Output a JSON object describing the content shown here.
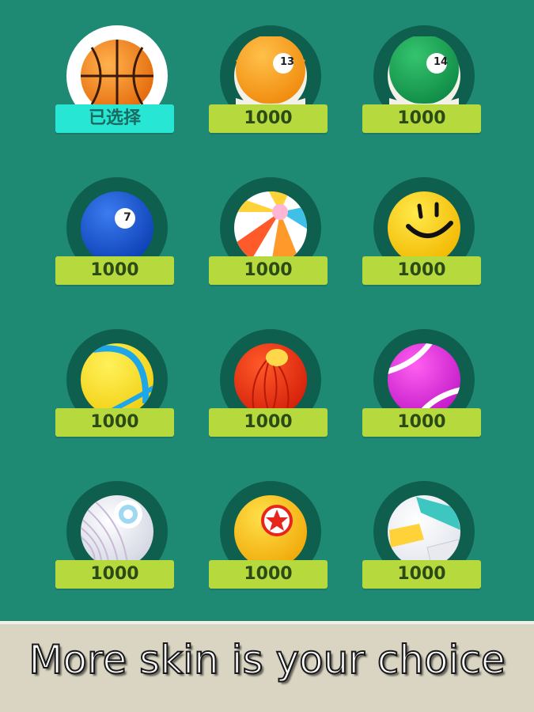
{
  "skins": [
    {
      "id": "basketball",
      "label": "已选择",
      "selected": true,
      "icon": "basketball-icon"
    },
    {
      "id": "pool-13",
      "label": "1000",
      "selected": false,
      "icon": "pool-ball-13-icon",
      "number": "13"
    },
    {
      "id": "pool-14",
      "label": "1000",
      "selected": false,
      "icon": "pool-ball-14-icon",
      "number": "14"
    },
    {
      "id": "pool-7",
      "label": "1000",
      "selected": false,
      "icon": "pool-ball-7-icon",
      "number": "7"
    },
    {
      "id": "beach",
      "label": "1000",
      "selected": false,
      "icon": "beach-ball-icon"
    },
    {
      "id": "smiley",
      "label": "1000",
      "selected": false,
      "icon": "smiley-ball-icon"
    },
    {
      "id": "tennis-yellow",
      "label": "1000",
      "selected": false,
      "icon": "yellow-tennis-ball-icon"
    },
    {
      "id": "red-ball",
      "label": "1000",
      "selected": false,
      "icon": "red-ball-icon"
    },
    {
      "id": "tennis-pink",
      "label": "1000",
      "selected": false,
      "icon": "pink-tennis-ball-icon"
    },
    {
      "id": "shuttle",
      "label": "1000",
      "selected": false,
      "icon": "white-ball-icon"
    },
    {
      "id": "star",
      "label": "1000",
      "selected": false,
      "icon": "star-ball-icon"
    },
    {
      "id": "volley",
      "label": "1000",
      "selected": false,
      "icon": "volleyball-icon"
    }
  ],
  "banner": {
    "text": "More skin is your choice"
  },
  "colors": {
    "background": "#1f8a73",
    "ring": "#0f5f4f",
    "price_tag": "#b6da3e",
    "selected_tag": "#27e6d4",
    "banner": "#d9d5c2"
  }
}
